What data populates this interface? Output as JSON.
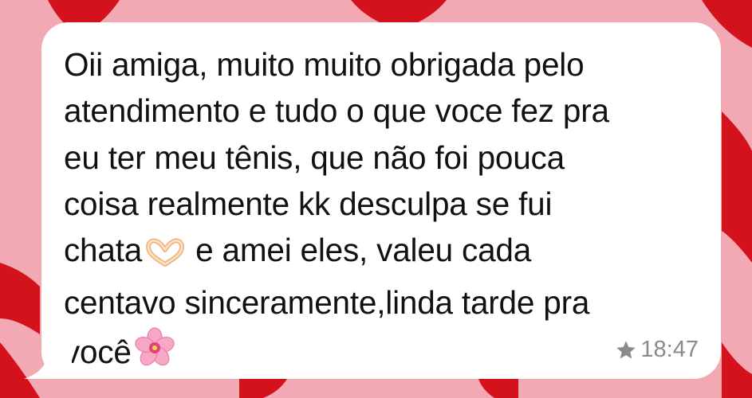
{
  "wallpaper": {
    "background_color": "#f2a9b3",
    "shape_color": "#d4121c",
    "pattern": "red-hearts-on-pink"
  },
  "message": {
    "bubble_color": "#ffffff",
    "lines": [
      "Oii amiga, muito muito obrigada pelo",
      "atendimento e tudo o que voce fez pra",
      "eu ter meu tênis, que não foi pouca",
      "coisa realmente kk desculpa se fui",
      "chata",
      " e amei eles, valeu cada",
      "centavo sinceramente,linda tarde pra",
      "você"
    ],
    "emojis": {
      "after_chata": "heart-hands-icon",
      "after_voce": "cherry-blossom-icon"
    },
    "starred_icon": "star-icon",
    "time": "18:47"
  }
}
